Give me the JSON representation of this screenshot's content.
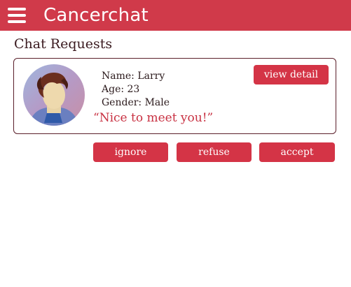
{
  "app": {
    "title": "Cancerchat"
  },
  "section": {
    "title": "Chat Requests"
  },
  "request": {
    "name_line": "Name: Larry",
    "age_line": "Age: 23",
    "gender_line": "Gender: Male",
    "message": "“Nice to meet you!”",
    "view_detail_label": "view detail"
  },
  "actions": {
    "ignore_label": "ignore",
    "refuse_label": "refuse",
    "accept_label": "accept"
  },
  "colors": {
    "appbar": "#d03a4a",
    "button": "#d43446",
    "quote": "#c83142"
  }
}
